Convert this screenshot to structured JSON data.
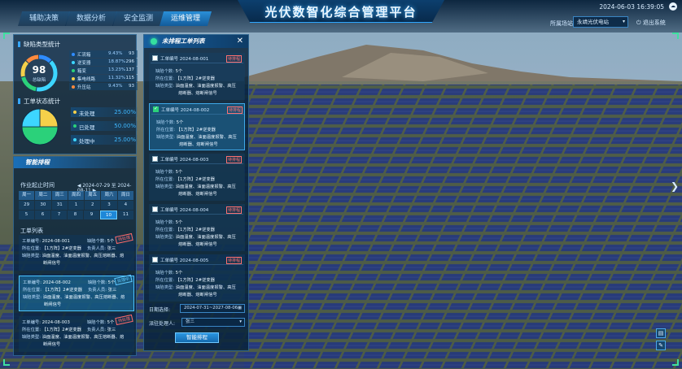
{
  "header": {
    "title": "光伏数智化综合管理平台",
    "datetime": "2024-06-03 16:39:05",
    "tabs": [
      "辅助决策",
      "数据分析",
      "安全监测",
      "运维管理"
    ],
    "active_tab_index": 3,
    "station_label": "所属场站:",
    "station_value": "永靖光伏电站",
    "logout": "退出系统"
  },
  "defect_stats": {
    "title": "缺陷类型统计",
    "total": "98",
    "total_label": "总缺陷",
    "items": [
      {
        "name": "汇流箱",
        "pct": "9.43%",
        "count": "93",
        "color": "#2f8cff"
      },
      {
        "name": "逆变器",
        "pct": "18.87%",
        "count": "296",
        "color": "#3dd6ff"
      },
      {
        "name": "箱变",
        "pct": "13.23%",
        "count": "137",
        "color": "#2bd17a"
      },
      {
        "name": "集电线路",
        "pct": "11.32%",
        "count": "115",
        "color": "#f5d04a"
      },
      {
        "name": "升压站",
        "pct": "9.43%",
        "count": "93",
        "color": "#ff8a3d"
      }
    ]
  },
  "order_status": {
    "title": "工单状态统计",
    "items": [
      {
        "name": "未处理",
        "pct": "25.00%",
        "color": "#f5d04a"
      },
      {
        "name": "已处理",
        "pct": "50.00%",
        "color": "#2bd17a"
      },
      {
        "name": "处理中",
        "pct": "25.00%",
        "color": "#3dd6ff"
      }
    ]
  },
  "smart": {
    "title": "智能排程",
    "period_label": "作业起止时间",
    "range_start": "2024-07-29",
    "range_sep": "至",
    "range_end": "2024-08-11",
    "weekdays": [
      "周一",
      "周二",
      "周三",
      "周四",
      "周五",
      "周六",
      "周日"
    ],
    "days": [
      [
        "29",
        "30",
        "31",
        "1",
        "2",
        "3",
        "4"
      ],
      [
        "5",
        "6",
        "7",
        "8",
        "9",
        "10",
        "11"
      ]
    ],
    "selected_day": "10",
    "list_title": "工单列表",
    "orders": [
      {
        "no_label": "工单编号:",
        "no": "2024-08-001",
        "count_label": "缺陷个数:",
        "count": "5个",
        "loc_label": "所在位置:",
        "loc": "【1方阵】2#逆变器",
        "person_label": "负责人员:",
        "person": "张三",
        "type_label": "缺陷类型:",
        "type1": "油面温度、油面温度报警、高压熔断器、熔",
        "type2": "断闸信号",
        "tag": "待处理"
      },
      {
        "no_label": "工单编号:",
        "no": "2024-08-002",
        "count_label": "缺陷个数:",
        "count": "5个",
        "loc_label": "所在位置:",
        "loc": "【1方阵】2#逆变器",
        "person_label": "负责人员:",
        "person": "张三",
        "type_label": "缺陷类型:",
        "type1": "油面温度、油面温度报警、高压熔断器、熔",
        "type2": "断闸信号",
        "tag": "处理中"
      },
      {
        "no_label": "工单编号:",
        "no": "2024-08-003",
        "count_label": "缺陷个数:",
        "count": "5个",
        "loc_label": "所在位置:",
        "loc": "【1方阵】2#逆变器",
        "person_label": "负责人员:",
        "person": "张三",
        "type_label": "缺陷类型:",
        "type1": "油面温度、油面温度报警、高压熔断器、熔",
        "type2": "断闸信号",
        "tag": "待处理"
      }
    ]
  },
  "pending": {
    "title": "未排程工单列表",
    "no_label": "工单编号",
    "tag": "待排程",
    "count_label": "缺陷个数:",
    "loc_label": "所在位置:",
    "type_label": "缺陷类型:",
    "items": [
      {
        "no": "2024-08-001",
        "checked": false,
        "count": "5个",
        "loc": "【1方阵】2#逆变器",
        "type1": "油面温度、油面温度报警、高压",
        "type2": "熔断器、熔断闸信号"
      },
      {
        "no": "2024-08-002",
        "checked": true,
        "count": "5个",
        "loc": "【1方阵】2#逆变器",
        "type1": "油面温度、油面温度报警、高压",
        "type2": "熔断器、熔断闸信号"
      },
      {
        "no": "2024-08-003",
        "checked": false,
        "count": "5个",
        "loc": "【1方阵】2#逆变器",
        "type1": "油面温度、油面温度报警、高压",
        "type2": "熔断器、熔断闸信号"
      },
      {
        "no": "2024-08-004",
        "checked": false,
        "count": "5个",
        "loc": "【1方阵】2#逆变器",
        "type1": "油面温度、油面温度报警、高压",
        "type2": "熔断器、熔断闸信号"
      },
      {
        "no": "2024-08-005",
        "checked": false,
        "count": "5个",
        "loc": "【1方阵】2#逆变器",
        "type1": "油面温度、油面温度报警、高压",
        "type2": "熔断器、熔断闸信号"
      }
    ],
    "date_label": "日期选择:",
    "date_value": "2024-07-31~2027-08-06",
    "person_label": "派驻处理人:",
    "person_value": "张三",
    "button": "智能排程"
  },
  "colors": {
    "accent": "#2f9bff",
    "panel": "#08233c",
    "warn": "#ff6a6a"
  }
}
